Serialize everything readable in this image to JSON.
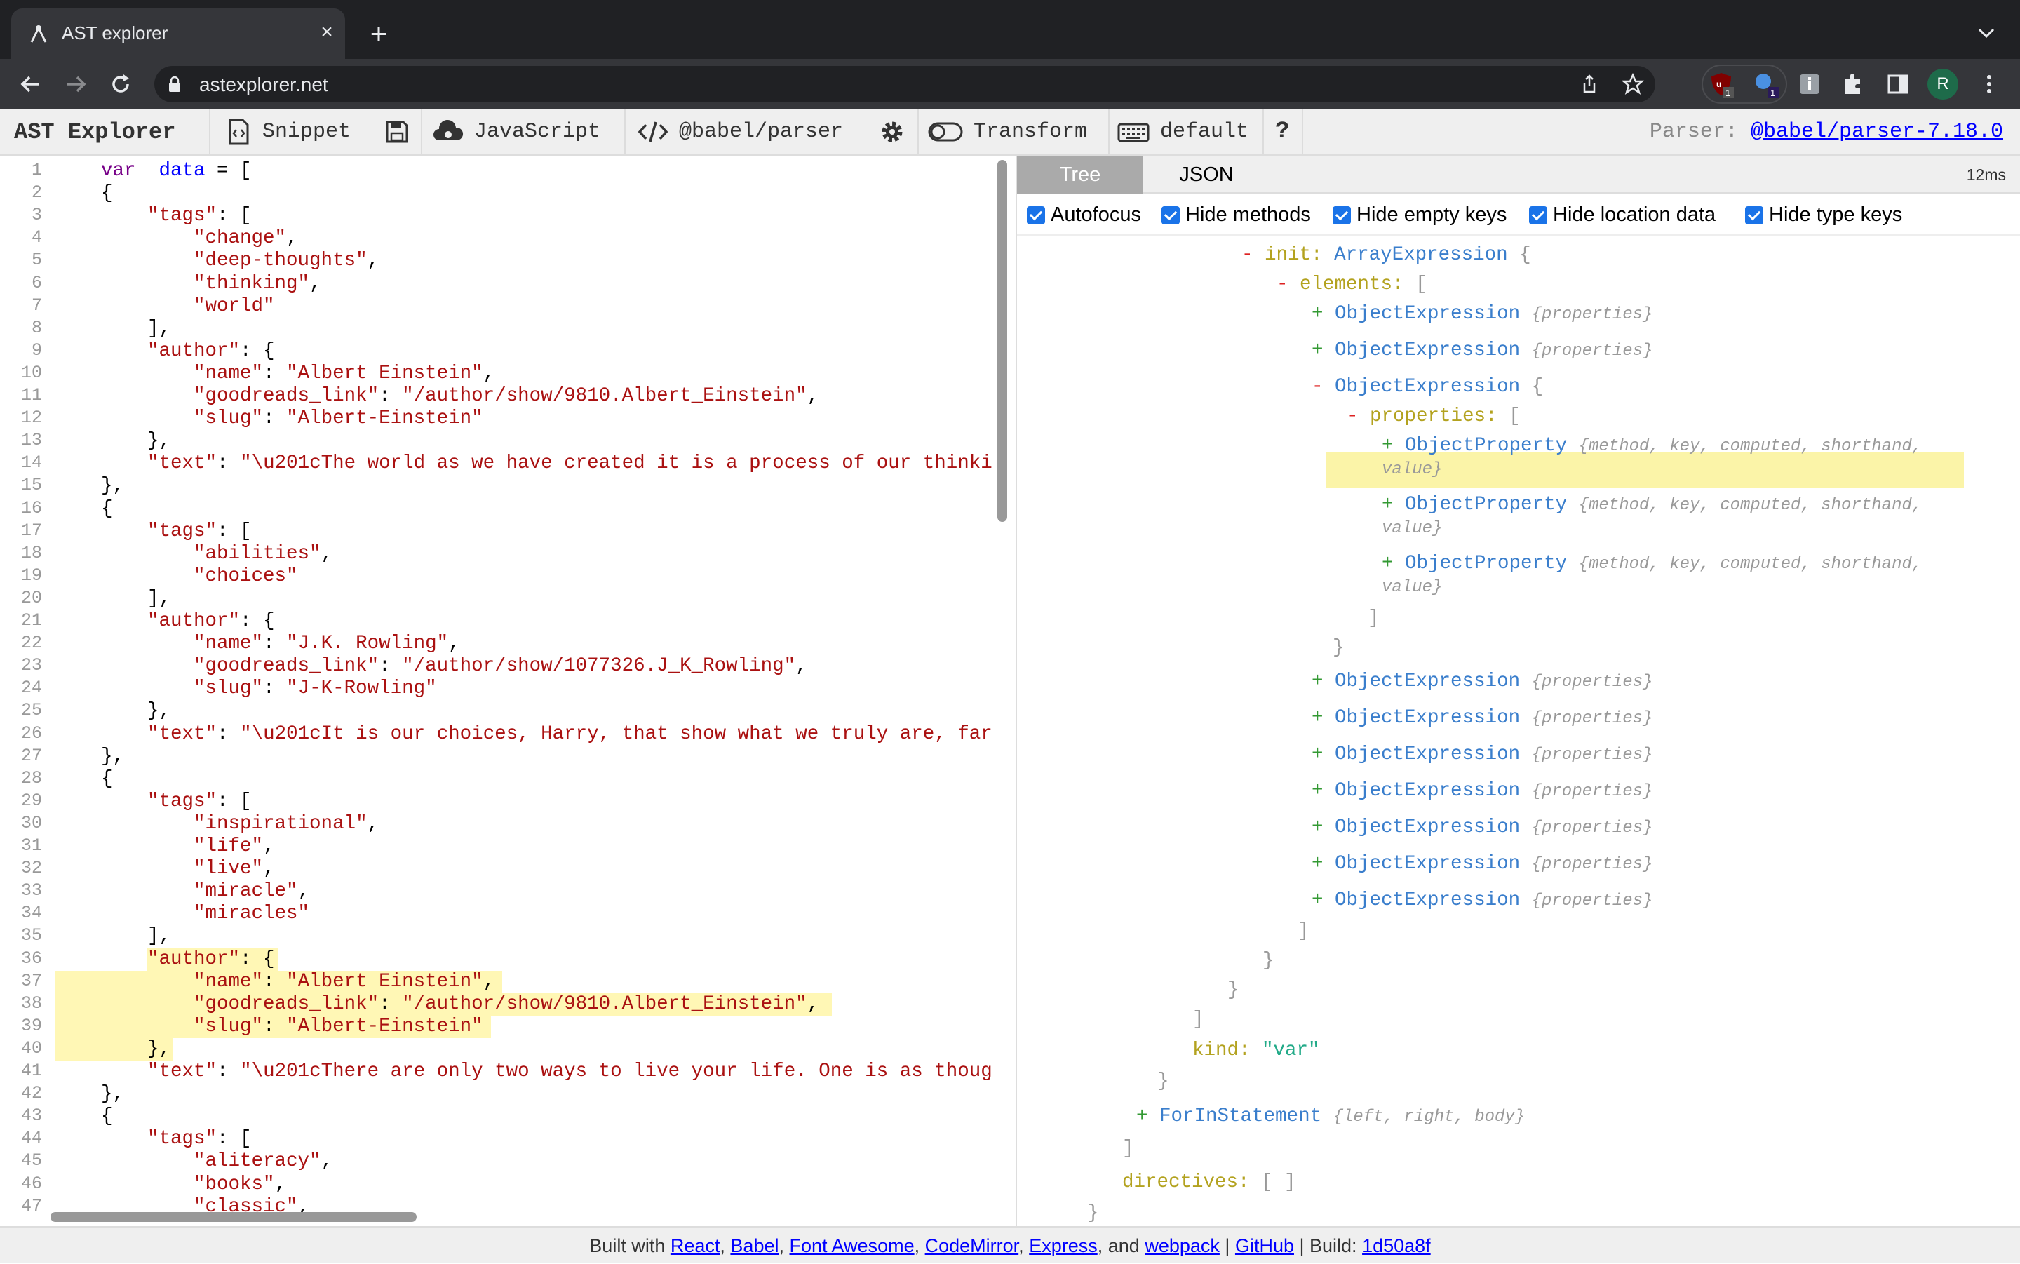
{
  "browser": {
    "tab_title": "AST explorer",
    "url": "astexplorer.net",
    "badge1": "1",
    "badge2": "1",
    "profile": "R"
  },
  "toolbar": {
    "brand": "AST Explorer",
    "snippet": "Snippet",
    "language": "JavaScript",
    "parser": "@babel/parser",
    "transform": "Transform",
    "keymap": "default",
    "help": "?",
    "parser_label": "Parser:",
    "parser_version": "@babel/parser-7.18.0"
  },
  "editor": {
    "line_numbers": [
      "1",
      "2",
      "3",
      "4",
      "5",
      "6",
      "7",
      "8",
      "9",
      "10",
      "11",
      "12",
      "13",
      "14",
      "15",
      "16",
      "17",
      "18",
      "19",
      "20",
      "21",
      "22",
      "23",
      "24",
      "25",
      "26",
      "27",
      "28",
      "29",
      "30",
      "31",
      "32",
      "33",
      "34",
      "35",
      "36",
      "37",
      "38",
      "39",
      "40",
      "41",
      "42",
      "43",
      "44",
      "45",
      "46",
      "47"
    ],
    "lines": [
      [
        [
          "kw",
          "var"
        ],
        [
          "",
          "  "
        ],
        [
          "vr",
          "data"
        ],
        [
          "",
          " = ["
        ]
      ],
      [
        [
          "",
          "{"
        ]
      ],
      [
        [
          "",
          "    "
        ],
        [
          "st",
          "\"tags\""
        ],
        [
          "",
          ": ["
        ]
      ],
      [
        [
          "",
          "        "
        ],
        [
          "st",
          "\"change\""
        ],
        [
          "",
          ","
        ]
      ],
      [
        [
          "",
          "        "
        ],
        [
          "st",
          "\"deep-thoughts\""
        ],
        [
          "",
          ","
        ]
      ],
      [
        [
          "",
          "        "
        ],
        [
          "st",
          "\"thinking\""
        ],
        [
          "",
          ","
        ]
      ],
      [
        [
          "",
          "        "
        ],
        [
          "st",
          "\"world\""
        ]
      ],
      [
        [
          "",
          "    ],"
        ]
      ],
      [
        [
          "",
          "    "
        ],
        [
          "st",
          "\"author\""
        ],
        [
          "",
          ": {"
        ]
      ],
      [
        [
          "",
          "        "
        ],
        [
          "st",
          "\"name\""
        ],
        [
          "",
          ": "
        ],
        [
          "st",
          "\"Albert Einstein\""
        ],
        [
          "",
          ","
        ]
      ],
      [
        [
          "",
          "        "
        ],
        [
          "st",
          "\"goodreads_link\""
        ],
        [
          "",
          ": "
        ],
        [
          "st",
          "\"/author/show/9810.Albert_Einstein\""
        ],
        [
          "",
          ","
        ]
      ],
      [
        [
          "",
          "        "
        ],
        [
          "st",
          "\"slug\""
        ],
        [
          "",
          ": "
        ],
        [
          "st",
          "\"Albert-Einstein\""
        ]
      ],
      [
        [
          "",
          "    },"
        ]
      ],
      [
        [
          "",
          "    "
        ],
        [
          "st",
          "\"text\""
        ],
        [
          "",
          ": "
        ],
        [
          "st",
          "\"\\u201cThe world as we have created it is a process of our thinki"
        ]
      ],
      [
        [
          "",
          "},"
        ]
      ],
      [
        [
          "",
          "{"
        ]
      ],
      [
        [
          "",
          "    "
        ],
        [
          "st",
          "\"tags\""
        ],
        [
          "",
          ": ["
        ]
      ],
      [
        [
          "",
          "        "
        ],
        [
          "st",
          "\"abilities\""
        ],
        [
          "",
          ","
        ]
      ],
      [
        [
          "",
          "        "
        ],
        [
          "st",
          "\"choices\""
        ]
      ],
      [
        [
          "",
          "    ],"
        ]
      ],
      [
        [
          "",
          "    "
        ],
        [
          "st",
          "\"author\""
        ],
        [
          "",
          ": {"
        ]
      ],
      [
        [
          "",
          "        "
        ],
        [
          "st",
          "\"name\""
        ],
        [
          "",
          ": "
        ],
        [
          "st",
          "\"J.K. Rowling\""
        ],
        [
          "",
          ","
        ]
      ],
      [
        [
          "",
          "        "
        ],
        [
          "st",
          "\"goodreads_link\""
        ],
        [
          "",
          ": "
        ],
        [
          "st",
          "\"/author/show/1077326.J_K_Rowling\""
        ],
        [
          "",
          ","
        ]
      ],
      [
        [
          "",
          "        "
        ],
        [
          "st",
          "\"slug\""
        ],
        [
          "",
          ": "
        ],
        [
          "st",
          "\"J-K-Rowling\""
        ]
      ],
      [
        [
          "",
          "    },"
        ]
      ],
      [
        [
          "",
          "    "
        ],
        [
          "st",
          "\"text\""
        ],
        [
          "",
          ": "
        ],
        [
          "st",
          "\"\\u201cIt is our choices, Harry, that show what we truly are, far"
        ]
      ],
      [
        [
          "",
          "},"
        ]
      ],
      [
        [
          "",
          "{"
        ]
      ],
      [
        [
          "",
          "    "
        ],
        [
          "st",
          "\"tags\""
        ],
        [
          "",
          ": ["
        ]
      ],
      [
        [
          "",
          "        "
        ],
        [
          "st",
          "\"inspirational\""
        ],
        [
          "",
          ","
        ]
      ],
      [
        [
          "",
          "        "
        ],
        [
          "st",
          "\"life\""
        ],
        [
          "",
          ","
        ]
      ],
      [
        [
          "",
          "        "
        ],
        [
          "st",
          "\"live\""
        ],
        [
          "",
          ","
        ]
      ],
      [
        [
          "",
          "        "
        ],
        [
          "st",
          "\"miracle\""
        ],
        [
          "",
          ","
        ]
      ],
      [
        [
          "",
          "        "
        ],
        [
          "st",
          "\"miracles\""
        ]
      ],
      [
        [
          "",
          "    ],"
        ]
      ],
      [
        [
          "",
          "    "
        ],
        [
          "st",
          "\"author\""
        ],
        [
          "",
          ": {"
        ]
      ],
      [
        [
          "",
          "        "
        ],
        [
          "st",
          "\"name\""
        ],
        [
          "",
          ": "
        ],
        [
          "st",
          "\"Albert Einstein\""
        ],
        [
          "",
          ","
        ]
      ],
      [
        [
          "",
          "        "
        ],
        [
          "st",
          "\"goodreads_link\""
        ],
        [
          "",
          ": "
        ],
        [
          "st",
          "\"/author/show/9810.Albert_Einstein\""
        ],
        [
          "",
          ","
        ]
      ],
      [
        [
          "",
          "        "
        ],
        [
          "st",
          "\"slug\""
        ],
        [
          "",
          ": "
        ],
        [
          "st",
          "\"Albert-Einstein\""
        ]
      ],
      [
        [
          "",
          "    },"
        ]
      ],
      [
        [
          "",
          "    "
        ],
        [
          "st",
          "\"text\""
        ],
        [
          "",
          ": "
        ],
        [
          "st",
          "\"\\u201cThere are only two ways to live your life. One is as thoug"
        ]
      ],
      [
        [
          "",
          "},"
        ]
      ],
      [
        [
          "",
          "{"
        ]
      ],
      [
        [
          "",
          "    "
        ],
        [
          "st",
          "\"tags\""
        ],
        [
          "",
          ": ["
        ]
      ],
      [
        [
          "",
          "        "
        ],
        [
          "st",
          "\"aliteracy\""
        ],
        [
          "",
          ","
        ]
      ],
      [
        [
          "",
          "        "
        ],
        [
          "st",
          "\"books\""
        ],
        [
          "",
          ","
        ]
      ],
      [
        [
          "",
          "        "
        ],
        [
          "st",
          "\"classic\""
        ],
        [
          "",
          ","
        ]
      ]
    ]
  },
  "output": {
    "tabs": [
      "Tree",
      "JSON"
    ],
    "timing": "12ms",
    "options": [
      "Autofocus",
      "Hide methods",
      "Hide empty keys",
      "Hide location data",
      "Hide type keys"
    ]
  },
  "tree": {
    "toggle_open": "-",
    "toggle_closed": "+",
    "init_key": "init:",
    "array_expr": "ArrayExpression",
    "elements_key": "elements:",
    "object_expr": "ObjectExpression",
    "props_summary": "{properties}",
    "properties_key": "properties:",
    "object_prop": "ObjectProperty",
    "objprop_summary": "{method, key, computed, shorthand, value}",
    "open_brace": "{",
    "close_brace": "}",
    "open_bracket": "[",
    "close_bracket": "]",
    "kind_key": "kind:",
    "kind_value": "\"var\"",
    "forin": "ForInStatement",
    "forin_summary": "{left, right, body}",
    "directives_key": "directives:",
    "empty_array": "[ ]"
  },
  "footer": {
    "built_with": "Built with",
    "links": [
      "React",
      "Babel",
      "Font Awesome",
      "CodeMirror",
      "Express",
      "webpack",
      "GitHub",
      "1d50a8f"
    ],
    "and": "and",
    "build": "Build:"
  }
}
